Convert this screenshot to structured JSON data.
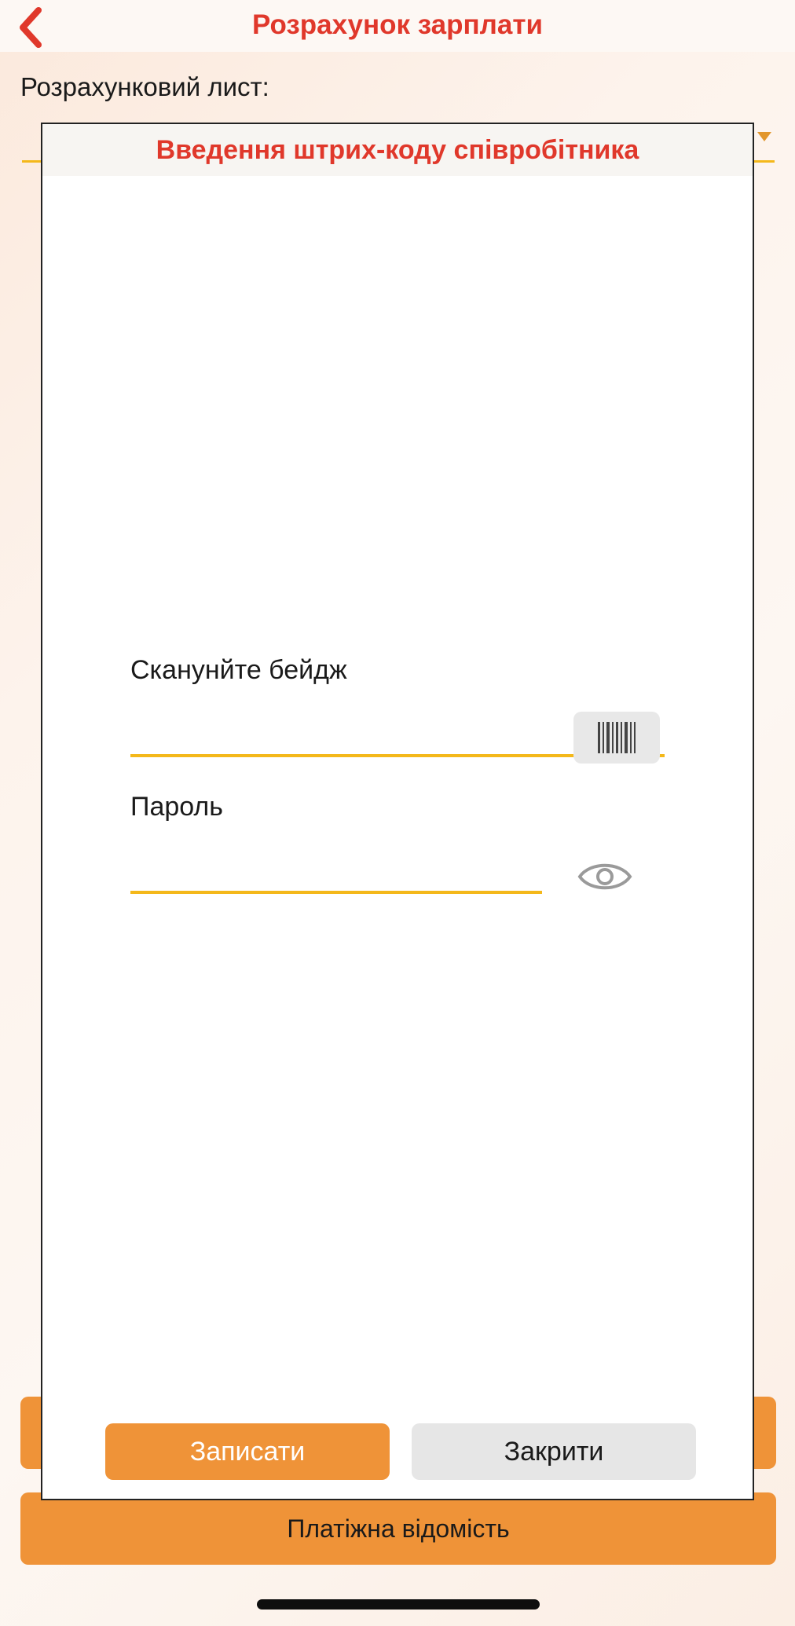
{
  "header": {
    "title": "Розрахунок зарплати",
    "back_icon": "chevron-left-icon"
  },
  "form": {
    "sheet_label": "Розрахунковий лист:",
    "sheet_value": ""
  },
  "buttons": {
    "hidden_button_label": "",
    "payroll_label": "Платіжна відомість"
  },
  "modal": {
    "title": "Введення штрих-коду співробітника",
    "badge_label": "Сканунйте бейдж",
    "badge_value": "",
    "password_label": "Пароль",
    "password_value": "",
    "scan_icon": "barcode-icon",
    "eye_icon": "eye-icon",
    "save_label": "Записати",
    "close_label": "Закрити"
  },
  "colors": {
    "accent": "#ef9338",
    "title_red": "#e0382b",
    "underline_yellow": "#f4b81a"
  }
}
